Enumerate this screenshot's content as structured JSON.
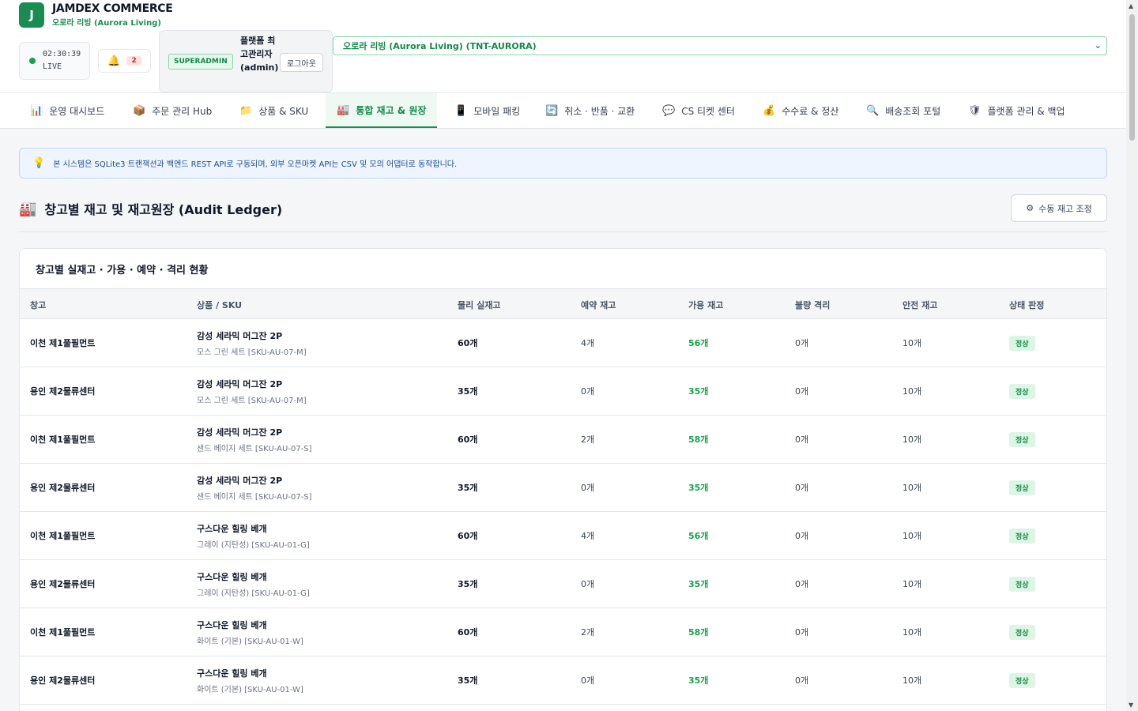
{
  "brand": {
    "logo_letter": "J",
    "name": "JAMDEX COMMERCE",
    "subtitle": "오로라 리빙 (Aurora Living)"
  },
  "clock": {
    "time": "02:30:39",
    "status": "LIVE"
  },
  "notifications": {
    "count": "2"
  },
  "user": {
    "role": "SUPERADMIN",
    "name": "플랫폼 최고관리자 (admin)",
    "logout": "로그아웃"
  },
  "tenant": {
    "selected": "오로라 리빙 (Aurora Living) (TNT-AURORA)"
  },
  "nav": {
    "items": [
      {
        "icon": "📊",
        "label": "운영 대시보드"
      },
      {
        "icon": "📦",
        "label": "주문 관리 Hub"
      },
      {
        "icon": "📁",
        "label": "상품 & SKU"
      },
      {
        "icon": "🏭",
        "label": "통합 재고 & 원장"
      },
      {
        "icon": "📱",
        "label": "모바일 패킹"
      },
      {
        "icon": "🔄",
        "label": "취소 · 반품 · 교환"
      },
      {
        "icon": "💬",
        "label": "CS 티켓 센터"
      },
      {
        "icon": "💰",
        "label": "수수료 & 정산"
      },
      {
        "icon": "🔍",
        "label": "배송조회 포털"
      },
      {
        "icon": "🛡",
        "label": "플랫폼 관리 & 백업"
      }
    ]
  },
  "info": {
    "text": "본 시스템은 SQLite3 트랜잭션과 백엔드 REST API로 구동되며, 외부 오픈마켓 API는 CSV 및 모의 어댑터로 동작합니다."
  },
  "page": {
    "title": "창고별 재고 및 재고원장 (Audit Ledger)",
    "adjust_button": "수동 재고 조정"
  },
  "table": {
    "title": "창고별 실재고 · 가용 · 예약 · 격리 현황",
    "headers": [
      "창고",
      "상품 / SKU",
      "물리 실재고",
      "예약 재고",
      "가용 재고",
      "불량 격리",
      "안전 재고",
      "상태 판정"
    ],
    "rows": [
      {
        "warehouse": "이천 제1풀필먼트",
        "product": "감성 세라믹 머그잔 2P",
        "sku": "모스 그린 세트 [SKU-AU-07-M]",
        "physical": "60개",
        "reserved": "4개",
        "available": "56개",
        "quarantine": "0개",
        "safety": "10개",
        "status": "정상"
      },
      {
        "warehouse": "용인 제2물류센터",
        "product": "감성 세라믹 머그잔 2P",
        "sku": "모스 그린 세트 [SKU-AU-07-M]",
        "physical": "35개",
        "reserved": "0개",
        "available": "35개",
        "quarantine": "0개",
        "safety": "10개",
        "status": "정상"
      },
      {
        "warehouse": "이천 제1풀필먼트",
        "product": "감성 세라믹 머그잔 2P",
        "sku": "샌드 베이지 세트 [SKU-AU-07-S]",
        "physical": "60개",
        "reserved": "2개",
        "available": "58개",
        "quarantine": "0개",
        "safety": "10개",
        "status": "정상"
      },
      {
        "warehouse": "용인 제2물류센터",
        "product": "감성 세라믹 머그잔 2P",
        "sku": "샌드 베이지 세트 [SKU-AU-07-S]",
        "physical": "35개",
        "reserved": "0개",
        "available": "35개",
        "quarantine": "0개",
        "safety": "10개",
        "status": "정상"
      },
      {
        "warehouse": "이천 제1풀필먼트",
        "product": "구스다운 힐링 베개",
        "sku": "그레이 (지탄성) [SKU-AU-01-G]",
        "physical": "60개",
        "reserved": "4개",
        "available": "56개",
        "quarantine": "0개",
        "safety": "10개",
        "status": "정상"
      },
      {
        "warehouse": "용인 제2물류센터",
        "product": "구스다운 힐링 베개",
        "sku": "그레이 (지탄성) [SKU-AU-01-G]",
        "physical": "35개",
        "reserved": "0개",
        "available": "35개",
        "quarantine": "0개",
        "safety": "10개",
        "status": "정상"
      },
      {
        "warehouse": "이천 제1풀필먼트",
        "product": "구스다운 힐링 베개",
        "sku": "화이트 (기본) [SKU-AU-01-W]",
        "physical": "60개",
        "reserved": "2개",
        "available": "58개",
        "quarantine": "0개",
        "safety": "10개",
        "status": "정상"
      },
      {
        "warehouse": "용인 제2물류센터",
        "product": "구스다운 힐링 베개",
        "sku": "화이트 (기본) [SKU-AU-01-W]",
        "physical": "35개",
        "reserved": "0개",
        "available": "35개",
        "quarantine": "0개",
        "safety": "10개",
        "status": "정상"
      }
    ]
  },
  "colors": {
    "brand": "#1a8c53",
    "available": "#16a34a",
    "info_bg": "#eef5ff"
  }
}
